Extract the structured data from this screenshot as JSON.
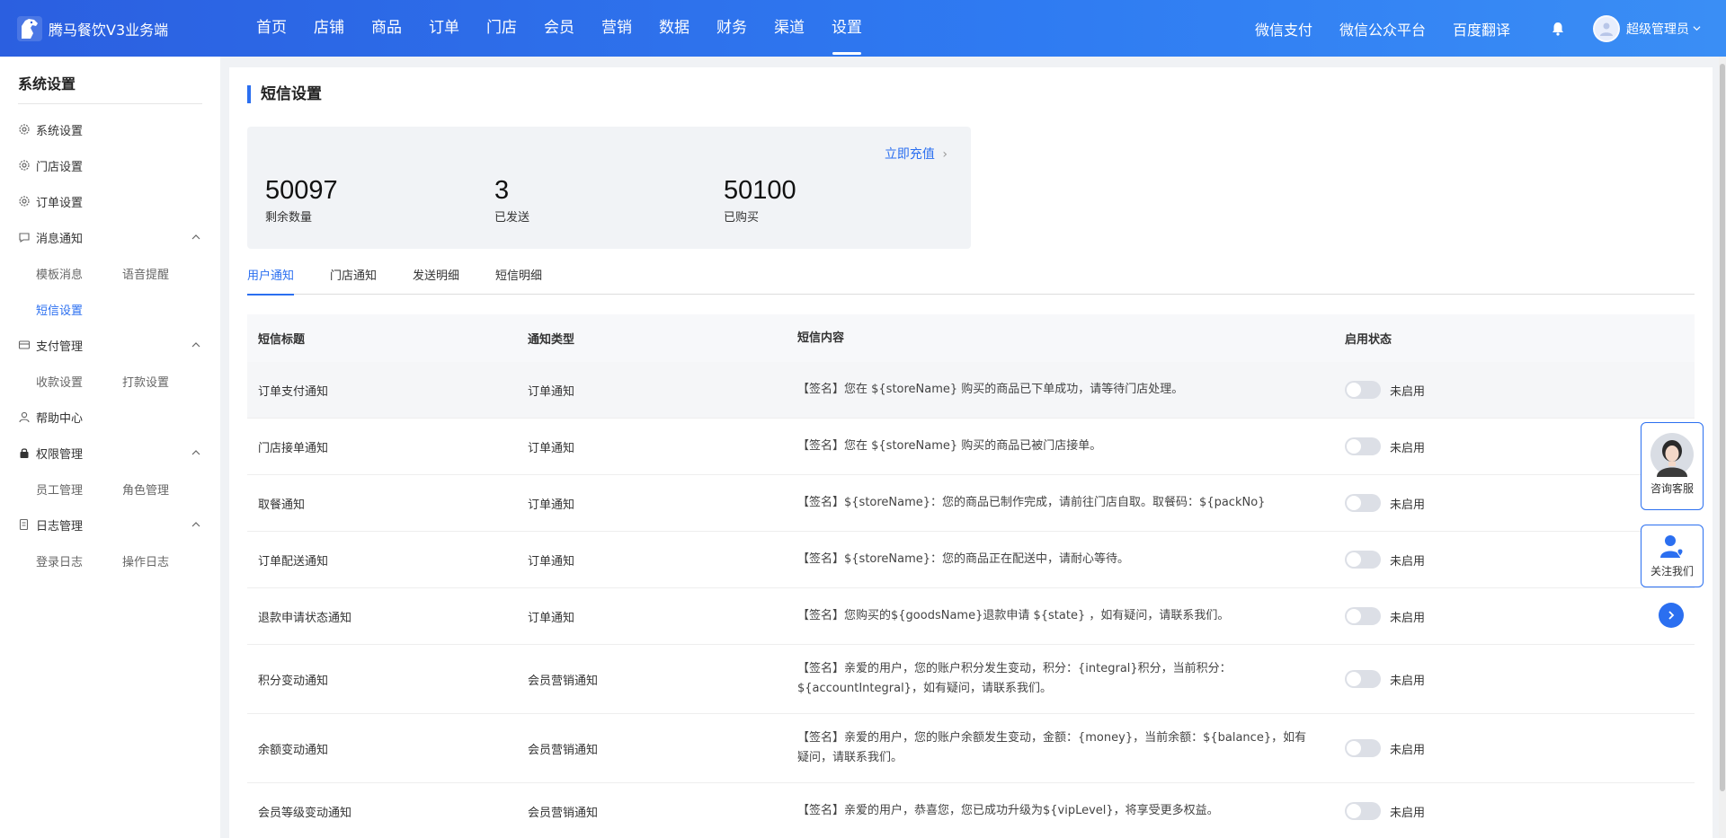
{
  "header": {
    "app_name": "腾马餐饮V3业务端",
    "nav": [
      "首页",
      "店铺",
      "商品",
      "订单",
      "门店",
      "会员",
      "营销",
      "数据",
      "财务",
      "渠道",
      "设置"
    ],
    "active_nav": "设置",
    "links": [
      "微信支付",
      "微信公众平台",
      "百度翻译"
    ],
    "user_name": "超级管理员"
  },
  "sidebar": {
    "title": "系统设置",
    "items": {
      "system": "系统设置",
      "store": "门店设置",
      "order": "订单设置",
      "message": "消息通知",
      "message_sub": [
        "模板消息",
        "语音提醒"
      ],
      "sms": "短信设置",
      "payment": "支付管理",
      "payment_sub": [
        "收款设置",
        "打款设置"
      ],
      "help": "帮助中心",
      "permission": "权限管理",
      "permission_sub": [
        "员工管理",
        "角色管理"
      ],
      "log": "日志管理",
      "log_sub": [
        "登录日志",
        "操作日志"
      ]
    }
  },
  "page": {
    "title": "短信设置",
    "recharge": "立即充值",
    "stats": [
      {
        "value": "50097",
        "label": "剩余数量"
      },
      {
        "value": "3",
        "label": "已发送"
      },
      {
        "value": "50100",
        "label": "已购买"
      }
    ],
    "tabs": [
      "用户通知",
      "门店通知",
      "发送明细",
      "短信明细"
    ],
    "table": {
      "headers": [
        "短信标题",
        "通知类型",
        "短信内容",
        "启用状态"
      ],
      "rows": [
        {
          "title": "订单支付通知",
          "type": "订单通知",
          "content": "【签名】您在 ${storeName} 购买的商品已下单成功，请等待门店处理。",
          "status": "未启用"
        },
        {
          "title": "门店接单通知",
          "type": "订单通知",
          "content": "【签名】您在 ${storeName} 购买的商品已被门店接单。",
          "status": "未启用"
        },
        {
          "title": "取餐通知",
          "type": "订单通知",
          "content": "【签名】${storeName}：您的商品已制作完成，请前往门店自取。取餐码：${packNo}",
          "status": "未启用"
        },
        {
          "title": "订单配送通知",
          "type": "订单通知",
          "content": "【签名】${storeName}：您的商品正在配送中，请耐心等待。",
          "status": "未启用"
        },
        {
          "title": "退款申请状态通知",
          "type": "订单通知",
          "content": "【签名】您购买的${goodsName}退款申请 ${state} ，如有疑问，请联系我们。",
          "status": "未启用"
        },
        {
          "title": "积分变动通知",
          "type": "会员营销通知",
          "content": "【签名】亲爱的用户，您的账户积分发生变动，积分：{integral}积分，当前积分：${accountIntegral}，如有疑问，请联系我们。",
          "status": "未启用"
        },
        {
          "title": "余额变动通知",
          "type": "会员营销通知",
          "content": "【签名】亲爱的用户，您的账户余额发生变动，金额：{money}，当前余额：${balance}，如有疑问，请联系我们。",
          "status": "未启用"
        },
        {
          "title": "会员等级变动通知",
          "type": "会员营销通知",
          "content": "【签名】亲爱的用户，恭喜您，您已成功升级为${vipLevel}，将享受更多权益。",
          "status": "未启用"
        }
      ]
    }
  },
  "widgets": {
    "consult": "咨询客服",
    "follow": "关注我们"
  }
}
